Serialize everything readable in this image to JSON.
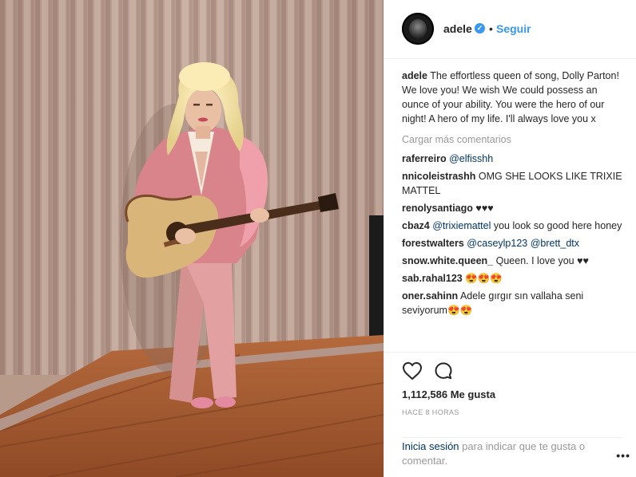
{
  "post": {
    "username": "adele",
    "follow_label": "Seguir",
    "dot": "•",
    "verified_mark": "✓",
    "caption_text": " The effortless queen of song, Dolly Parton! We love you! We wish We could possess an ounce of your ability. You were the hero of our night! A hero of my life. I'll always love you x"
  },
  "load_more_label": "Cargar más comentarios",
  "comments": [
    {
      "user": "raferreiro",
      "mention": "@elfisshh",
      "text": ""
    },
    {
      "user": "nnicoleistrashh",
      "mention": "",
      "text": " OMG SHE LOOKS LIKE TRIXIE MATTEL"
    },
    {
      "user": "renolysantiago",
      "mention": "",
      "text": " ♥♥♥"
    },
    {
      "user": "cbaz4",
      "mention": "@trixiemattel",
      "text": " you look so good here honey"
    },
    {
      "user": "forestwalters",
      "mention": "@caseylp123 @brett_dtx",
      "text": ""
    },
    {
      "user": "snow.white.queen_",
      "mention": "",
      "text": " Queen. I love you ♥♥"
    },
    {
      "user": "sab.rahal123",
      "mention": "",
      "text": " 😍😍😍"
    },
    {
      "user": "oner.sahinn",
      "mention": "",
      "text": " Adele gırgır sın vallaha seni seviyorum😍😍"
    }
  ],
  "likes": "1,112,586 Me gusta",
  "timestamp": "HACE 8 HORAS",
  "login": {
    "link": "Inicia sesión",
    "text": " para indicar que te gusta o comentar."
  },
  "more_label": "•••",
  "icons": {
    "heart": "heart-icon",
    "comment": "comment-icon",
    "verified": "verified-icon",
    "avatar": "avatar"
  },
  "colors": {
    "link_blue": "#3897f0",
    "mention_blue": "#003569",
    "muted": "#999999",
    "text": "#262626",
    "divider": "#efefef"
  }
}
